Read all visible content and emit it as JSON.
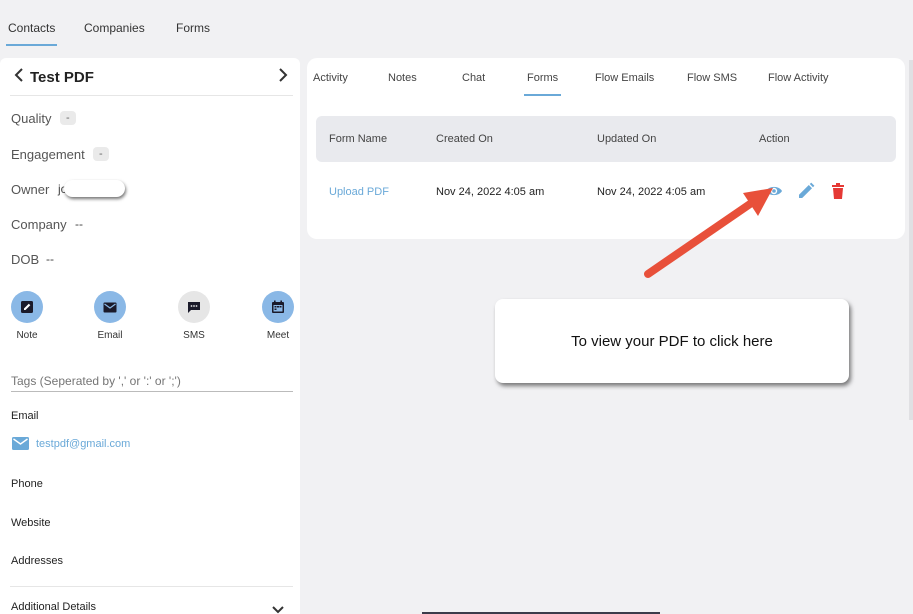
{
  "topnav": {
    "tabs": [
      {
        "label": "Contacts",
        "active": true
      },
      {
        "label": "Companies",
        "active": false
      },
      {
        "label": "Forms",
        "active": false
      }
    ]
  },
  "contact": {
    "name": "Test PDF",
    "quality_label": "Quality",
    "quality_value": "-",
    "engagement_label": "Engagement",
    "engagement_value": "-",
    "owner_label": "Owner",
    "owner_value": "jc",
    "company_label": "Company",
    "company_value": "--",
    "dob_label": "DOB",
    "dob_value": "--"
  },
  "actions": [
    {
      "label": "Note",
      "icon": "note-edit-icon"
    },
    {
      "label": "Email",
      "icon": "envelope-icon"
    },
    {
      "label": "SMS",
      "icon": "chat-bubble-icon"
    },
    {
      "label": "Meet",
      "icon": "calendar-icon"
    }
  ],
  "tags": {
    "placeholder": "Tags (Seperated by ',' or ':' or ';')"
  },
  "details": {
    "email_label": "Email",
    "email_value": "testpdf@gmail.com",
    "phone_label": "Phone",
    "website_label": "Website",
    "addresses_label": "Addresses",
    "additional_label": "Additional Details"
  },
  "card_tabs": [
    {
      "label": "Activity",
      "active": false
    },
    {
      "label": "Notes",
      "active": false
    },
    {
      "label": "Chat",
      "active": false
    },
    {
      "label": "Forms",
      "active": true
    },
    {
      "label": "Flow Emails",
      "active": false
    },
    {
      "label": "Flow SMS",
      "active": false
    },
    {
      "label": "Flow Activity",
      "active": false
    }
  ],
  "table": {
    "headers": [
      "Form Name",
      "Created On",
      "Updated On",
      "Action"
    ],
    "rows": [
      {
        "form_name": "Upload PDF",
        "created_on": "Nov 24, 2022 4:05 am",
        "updated_on": "Nov 24, 2022 4:05 am"
      }
    ]
  },
  "callout": {
    "text": "To view your PDF to click here"
  },
  "colors": {
    "accent": "#6aa9d8",
    "action_circle": "#8ab8e6",
    "sms_circle": "#e6e6e6",
    "arrow": "#e8503a",
    "delete": "#e53935"
  }
}
